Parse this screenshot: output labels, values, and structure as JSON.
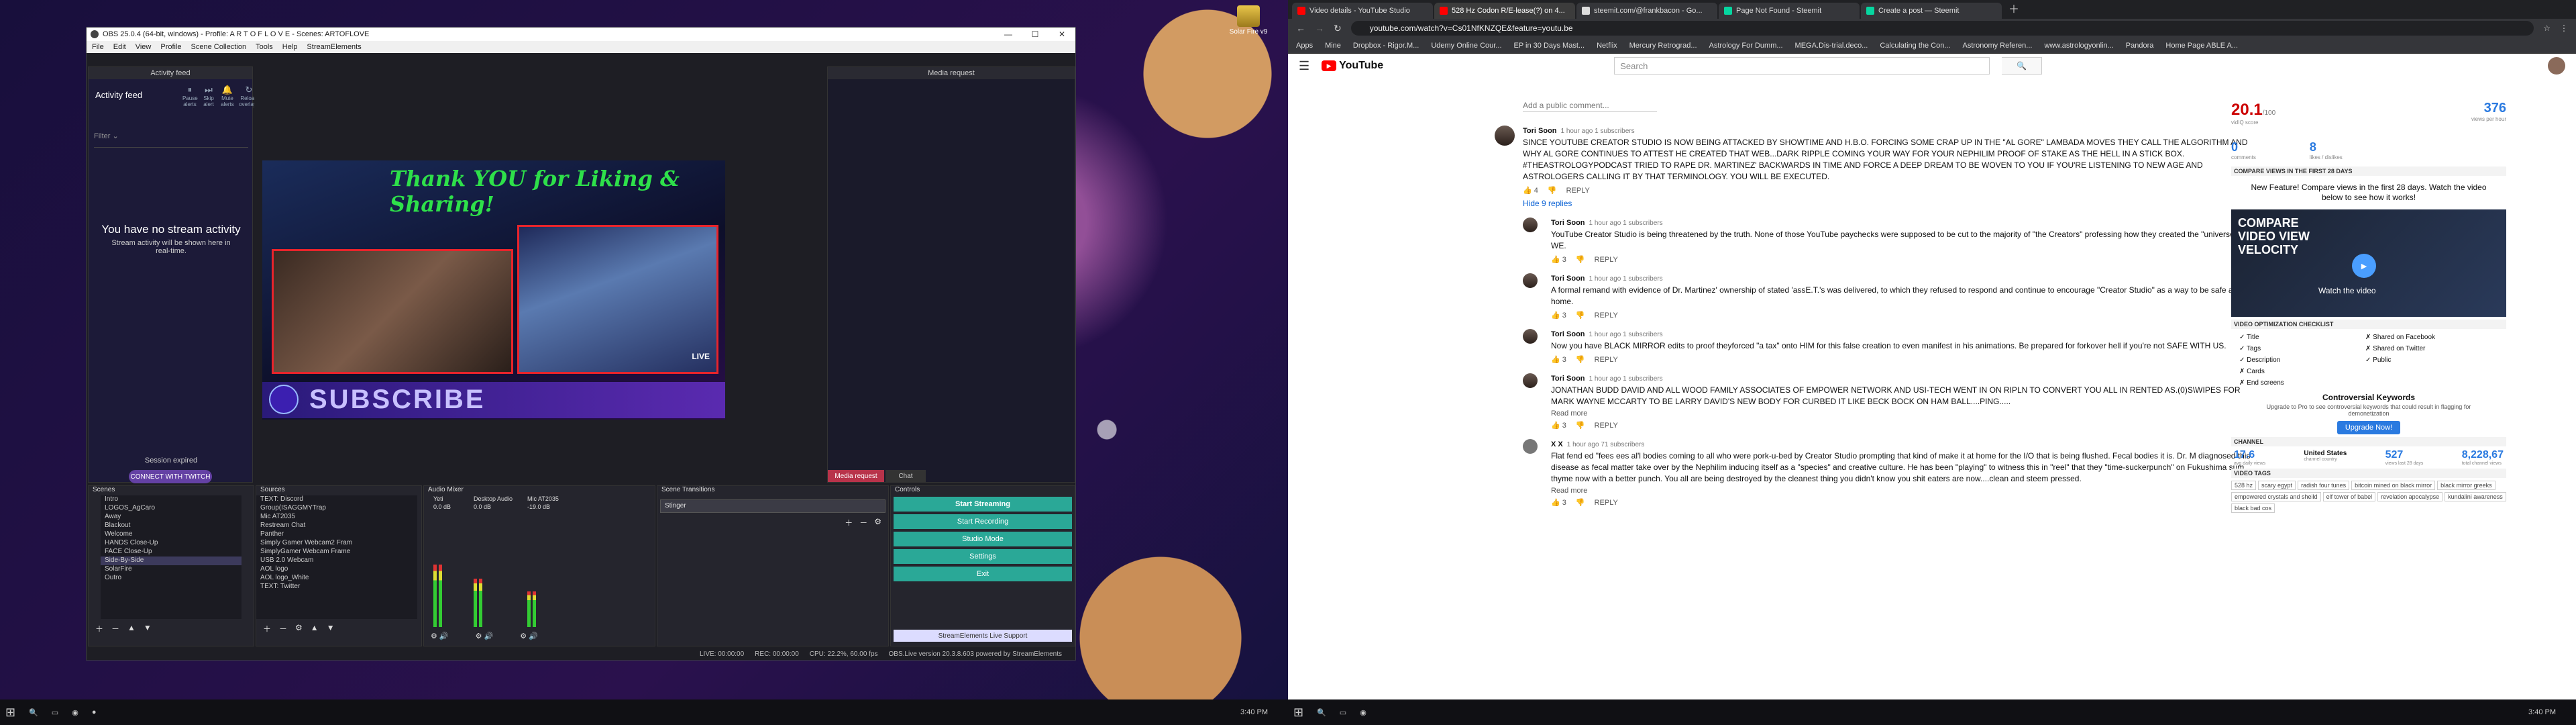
{
  "desktop": {
    "icon_label": "Solar Fire v9"
  },
  "obs": {
    "title": "OBS 25.0.4 (64-bit, windows) - Profile: A R T O F L O V E - Scenes: ARTOFLOVE",
    "menu": [
      "File",
      "Edit",
      "View",
      "Profile",
      "Scene Collection",
      "Tools",
      "Help",
      "StreamElements"
    ],
    "activity_feed": {
      "title": "Activity feed",
      "label": "Activity feed",
      "actions": [
        "Pause alerts",
        "Skip alert",
        "Mute alerts",
        "Reload overlays"
      ],
      "filter": "Filter",
      "empty_title": "You have no stream activity",
      "empty_text": "Stream activity will be shown here in real-time.",
      "session": "Session expired",
      "connect": "CONNECT WITH TWITCH"
    },
    "preview": {
      "banner": "Thank YOU for Liking & Sharing!",
      "subscribe": "SUBSCRIBE",
      "cam_label": "LIVE"
    },
    "media_request": {
      "title": "Media request",
      "tabs": [
        "Media request",
        "Chat"
      ]
    },
    "scenes": {
      "title": "Scenes",
      "items": [
        "Intro",
        "LOGOS_AgCaro",
        "Away",
        "Blackout",
        "Welcome",
        "HANDS Close-Up",
        "FACE Close-Up",
        "Side-By-Side",
        "SolarFire",
        "Outro"
      ]
    },
    "sources": {
      "title": "Sources",
      "items": [
        "TEXT: Discord",
        "Group(ISAGGMYTrap",
        "Mic AT2035",
        "Restream Chat",
        "Panther",
        "Simply Gamer Webcam2 Fram",
        "SimplyGamer Webcam Frame",
        "USB 2.0 Webcam",
        "AOL logo",
        "AOL logo_White",
        "TEXT: Twitter"
      ]
    },
    "mixer": {
      "title": "Audio Mixer",
      "channels": [
        {
          "name": "Yeti",
          "db": "0.0 dB",
          "level": 0.62
        },
        {
          "name": "Desktop Audio",
          "db": "0.0 dB",
          "level": 0.48
        },
        {
          "name": "Mic AT2035",
          "db": "-19.0 dB",
          "level": 0.35
        }
      ]
    },
    "transitions": {
      "title": "Scene Transitions",
      "value": "Stinger"
    },
    "controls": {
      "title": "Controls",
      "buttons": [
        "Start Streaming",
        "Start Recording",
        "Studio Mode",
        "Settings",
        "Exit"
      ],
      "support": "StreamElements Live Support"
    },
    "status": {
      "live": "LIVE: 00:00:00",
      "rec": "REC: 00:00:00",
      "cpu": "CPU: 22.2%, 60.00 fps",
      "version": "OBS.Live version 20.3.8.603 powered by StreamElements"
    }
  },
  "chrome": {
    "tabs": [
      "Video details - YouTube Studio",
      "528 Hz Codon R/E-lease(?) on 4...",
      "steemit.com/@frankbacon - Go...",
      "Page Not Found - Steemit",
      "Create a post — Steemit"
    ],
    "url": "youtube.com/watch?v=Cs01NfKNZQE&feature=youtu.be",
    "bookmarks": [
      "Apps",
      "Mine",
      "Dropbox - Rigor.M...",
      "Udemy Online Cour...",
      "EP in 30 Days Mast...",
      "Netflix",
      "Mercury Retrograd...",
      "Astrology For Dumm...",
      "MEGA.Dis-trial.deco...",
      "Calculating the Con...",
      "Astronomy Referen...",
      "www.astrologyonlin...",
      "Pandora",
      "Home Page ABLE A..."
    ]
  },
  "youtube": {
    "logo": "YouTube",
    "search_placeholder": "Search",
    "add_comment": "Add a public comment...",
    "comments": [
      {
        "name": "Tori Soon",
        "meta": "1 hour ago 1 subscribers",
        "text": "SINCE YOUTUBE CREATOR STUDIO IS NOW BEING ATTACKED BY SHOWTIME AND H.B.O. FORCING SOME CRAP UP IN THE \"AL GORE\" LAMBADA MOVES THEY CALL THE ALGORITHM AND WHY AL GORE CONTINUES TO ATTEST HE CREATED THAT WEB...DARK RIPPLE COMING YOUR WAY FOR YOUR NEPHILIM PROOF OF STAKE AS THE HELL IN A STICK BOX. #THEASTROLOGYPODCAST TRIED TO RAPE DR. MARTINEZ' BACKWARDS IN TIME AND FORCE A DEEP DREAM TO BE WOVEN TO YOU IF YOU'RE LISTENING TO NEW AGE AND ASTROLOGERS CALLING IT BY THAT TERMINOLOGY. YOU WILL BE EXECUTED.",
        "likes": "4",
        "replies_toggle": "Hide 9 replies"
      },
      {
        "name": "Tori Soon",
        "meta": "1 hour ago 1 subscribers",
        "text": "YouTube Creator Studio is being threatened by the truth. None of those YouTube paychecks were supposed to be cut to the majority of \"the Creators\" professing how they created the \"universe\" as a WE.",
        "likes": "3"
      },
      {
        "name": "Tori Soon",
        "meta": "1 hour ago 1 subscribers",
        "text": "A formal remand with evidence of Dr. Martinez' ownership of stated 'assE.T.'s was delivered, to which they refused to respond and continue to encourage \"Creator Studio\" as a way to be safe at home.",
        "likes": "3"
      },
      {
        "name": "Tori Soon",
        "meta": "1 hour ago 1 subscribers",
        "text": "Now you have BLACK MIRROR edits to proof theyforced \"a tax\" onto HIM for this false creation to even manifest in his animations. Be prepared for forkover hell if you're not SAFE WITH US.",
        "likes": "3"
      },
      {
        "name": "Tori Soon",
        "meta": "1 hour ago 1 subscribers",
        "text": "JONATHAN BUDD DAVID AND ALL WOOD FAMILY ASSOCIATES OF EMPOWER NETWORK AND USI-TECH WENT IN ON RIPLN TO CONVERT YOU ALL IN RENTED AS.(0)S\\WIPES FOR MARK WAYNE MCCARTY TO BE LARRY DAVID'S NEW BODY FOR CURBED IT LIKE BECK BOCK ON HAM BALL....PING.....",
        "likes": "3",
        "more": "Read more"
      },
      {
        "name": "X X",
        "meta": "1 hour ago 71 subscribers",
        "text": "Flat fend ed \"fees ees al'l bodies coming to all who were pork-u-bed by Creator Studio prompting that kind of make it at home for the I/O that is being flushed. Fecal bodies it is. Dr. M diagnosed this disease as fecal matter take over by the Nephilim inducing itself as a \"species\" and creative culture. He has been \"playing\" to witness this in \"reel\" that they \"time-suckerpunch\" on Fukushima sum thyme now with a better punch. You all are being destroyed by the cleanest thing you didn't know you shit eaters are now....clean and steem pressed.",
        "likes": "3",
        "more": "Read more"
      }
    ],
    "reply_label": "REPLY"
  },
  "vidiq": {
    "score": "20.1",
    "score_sub": "/100",
    "score_label": "vidIQ score",
    "views": "376",
    "views_label": "views per hour",
    "comments": "0",
    "comments_label": "comments",
    "likes": "8",
    "likes_label": "likes / dislikes",
    "compare_title": "COMPARE VIEWS IN THE FIRST 28 DAYS",
    "compare_text": "New Feature! Compare views in the first 28 days. Watch the video below to see how it works!",
    "compare_thumb_title": "COMPARE VIDEO VIEW VELOCITY",
    "watch_label": "Watch the video",
    "checklist_title": "VIDEO OPTIMIZATION CHECKLIST",
    "checklist_left": [
      "Title",
      "Tags",
      "Description",
      "Cards",
      "End screens"
    ],
    "checklist_right": [
      "Shared on Facebook",
      "Shared on Twitter",
      "Public"
    ],
    "controversial_title": "Controversial Keywords",
    "controversial_text": "Upgrade to Pro to see controversial keywords that could result in flagging for demonetization",
    "upgrade": "Upgrade Now!",
    "channel_title": "CHANNEL",
    "channel_stats": [
      "17.6",
      "United States",
      "527",
      "8,228,67"
    ],
    "channel_labels": [
      "avg daily views",
      "channel country",
      "views last 28 days",
      "total channel views"
    ],
    "tags_title": "VIDEO TAGS",
    "tags": [
      "528 hz",
      "scary egypt",
      "radish four tunes",
      "bitcoin mined on black mirror",
      "black mirror greeks",
      "empowered crystals and sheild",
      "elf tower of babel",
      "revelation apocalypse",
      "kundalini awareness",
      "black bad cos"
    ]
  },
  "taskbar": {
    "time_left": "3:40 PM",
    "time_right": "3:40 PM"
  }
}
